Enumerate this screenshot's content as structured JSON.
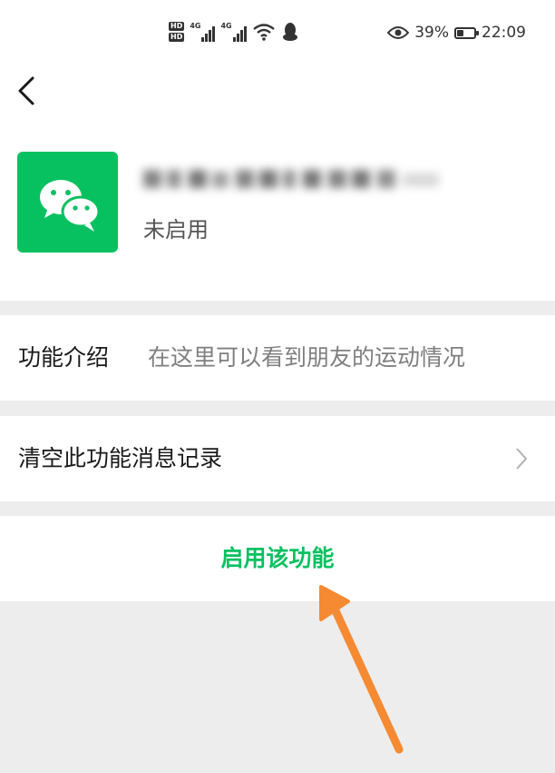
{
  "status_bar": {
    "hd1": "HD",
    "hd2": "HD",
    "net1": "4G",
    "net2": "4G",
    "battery_percent": "39%",
    "battery_level": 0.39,
    "time": "22:09"
  },
  "nav": {
    "back_icon": "chevron-left-icon"
  },
  "app": {
    "icon": "wechat-icon",
    "icon_color": "#07c160",
    "status": "未启用"
  },
  "intro": {
    "label": "功能介绍",
    "value": "在这里可以看到朋友的运动情况"
  },
  "clear_history": {
    "label": "清空此功能消息记录"
  },
  "enable": {
    "label": "启用该功能",
    "color": "#07c160"
  },
  "annotation": {
    "arrow_color": "#f58a33"
  }
}
